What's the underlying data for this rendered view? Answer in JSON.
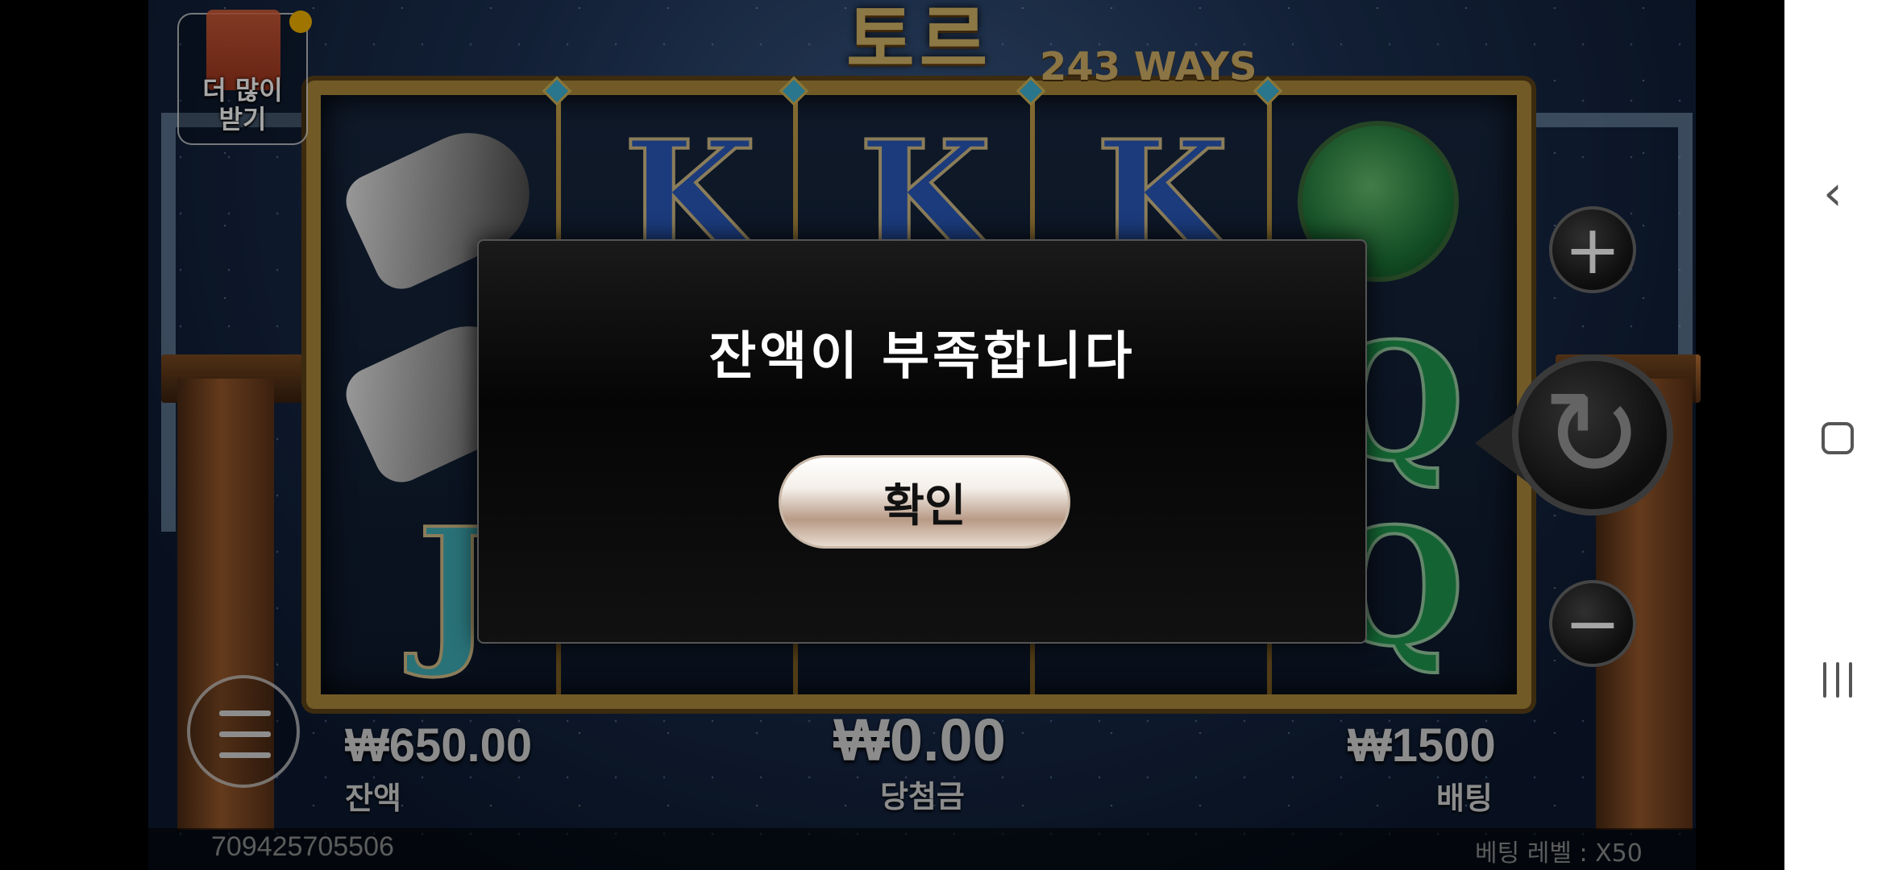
{
  "game": {
    "title": "토르",
    "ways": "243 WAYS",
    "gift_button_label": "더 많이\n받기",
    "balance_value": "₩650.00",
    "balance_label": "잔액",
    "win_value": "₩0.00",
    "win_label": "당첨금",
    "bet_value": "₩1500",
    "bet_label": "배팅",
    "session_id": "709425705506",
    "bet_level": "베팅 레벨 : X50",
    "symbols": {
      "k": "K",
      "q": "Q",
      "j": "J"
    }
  },
  "modal": {
    "message": "잔액이 부족합니다",
    "ok_label": "확인"
  },
  "icons": {
    "plus": "+",
    "minus": "−",
    "spin": "↻",
    "back": "‹"
  }
}
